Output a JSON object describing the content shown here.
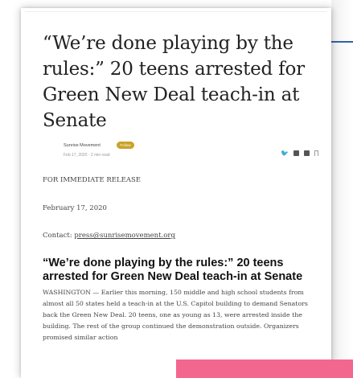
{
  "article": {
    "headline": "“We’re done playing by the rules:” 20 teens arrested for Green New Deal teach-in at Senate",
    "author": "Sunrise Movement",
    "follow_label": "Follow",
    "meta": "Feb 17, 2020 · 2 min read",
    "share_icons": [
      "twitter-icon",
      "linkedin-icon",
      "facebook-icon",
      "bookmark-icon"
    ],
    "release_label": "FOR IMMEDIATE RELEASE",
    "date": "February 17, 2020",
    "contact_label": "Contact:",
    "contact_email": "press@sunrisemovement.org",
    "subhead": "“We’re done playing by the rules:” 20 teens arrested for Green New Deal teach-in at Senate",
    "body": "WASHINGTON — Earlier this morning, 150 middle and high school students from almost all 50 states held a teach-in at the U.S. Capitol building to demand Senators back the Green New Deal. 20 teens, one as young as 13, were arrested inside the building. The rest of the group continued the demonstration outside. Organizers promised similar action"
  },
  "colors": {
    "follow_badge": "#c9a227",
    "accent_line": "#2f63a8",
    "pink_block": "#f3678e"
  }
}
